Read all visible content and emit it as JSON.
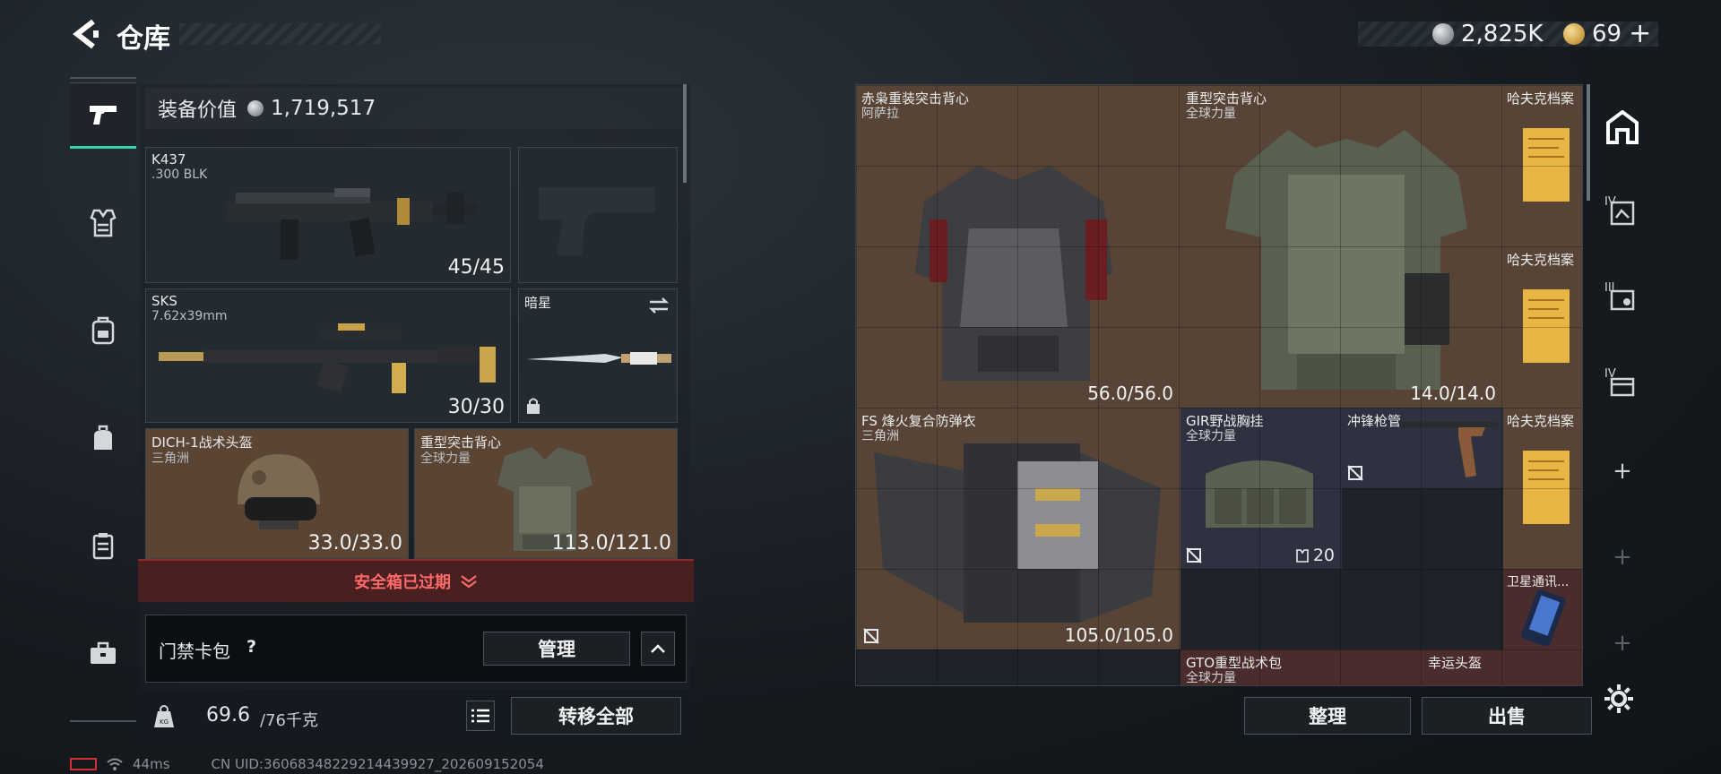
{
  "header": {
    "back_icon": "back-arrow-icon",
    "title": "仓库",
    "silver_amount": "2,825K",
    "gold_amount": "69",
    "gold_plus": "+"
  },
  "left_nav": {
    "items": [
      {
        "name": "weapons",
        "icon": "pistol-icon",
        "glyph": "⌐"
      },
      {
        "name": "vest",
        "icon": "vest-icon",
        "glyph": "⛊"
      },
      {
        "name": "backpack",
        "icon": "backpack-icon",
        "glyph": "⊡"
      },
      {
        "name": "bag",
        "icon": "bag-icon",
        "glyph": "◉"
      },
      {
        "name": "case",
        "icon": "case-icon",
        "glyph": "▤"
      },
      {
        "name": "toolbox",
        "icon": "toolbox-icon",
        "glyph": "⊟"
      }
    ]
  },
  "equipment": {
    "value_label": "装备价值",
    "value": "1,719,517",
    "primary": {
      "name": "K437",
      "ammo": ".300 BLK",
      "count": "45/45"
    },
    "sidearm": {
      "name": "",
      "count": ""
    },
    "secondary": {
      "name": "SKS",
      "ammo": "7.62x39mm",
      "count": "30/30"
    },
    "melee": {
      "name": "暗星"
    },
    "helmet": {
      "name": "DICH-1战术头盔",
      "origin": "三角洲",
      "count": "33.0/33.0"
    },
    "armor": {
      "name": "重型突击背心",
      "origin": "全球力量",
      "count": "113.0/121.0"
    },
    "safe_box": "安全箱已过期",
    "card_pack": "门禁卡包",
    "help_mark": "?",
    "manage": "管理",
    "weight": "69.6",
    "weight_max": "/76千克",
    "transfer_all": "转移全部"
  },
  "stash": {
    "items": [
      {
        "name": "赤枭重装突击背心",
        "origin": "阿萨拉",
        "count": "56.0/56.0"
      },
      {
        "name": "重型突击背心",
        "origin": "全球力量",
        "count": "14.0/14.0"
      },
      {
        "name": "哈夫克档案",
        "origin": "",
        "count": ""
      },
      {
        "name": "哈夫克档案",
        "origin": "",
        "count": ""
      },
      {
        "name": "FS 烽火复合防弹衣",
        "origin": "三角洲",
        "count": "105.0/105.0"
      },
      {
        "name": "GIR野战胸挂",
        "origin": "全球力量",
        "count": "20"
      },
      {
        "name": "冲锋枪管",
        "origin": "",
        "count": ""
      },
      {
        "name": "哈夫克档案",
        "origin": "",
        "count": ""
      },
      {
        "name": "卫星通讯...",
        "origin": "",
        "count": ""
      },
      {
        "name": "GTO重型战术包",
        "origin": "全球力量",
        "count": ""
      },
      {
        "name": "幸运头盔",
        "origin": "",
        "count": ""
      }
    ],
    "organize": "整理",
    "sell": "出售"
  },
  "right_nav": {
    "items": [
      {
        "label": "",
        "icon": "stash-home-icon"
      },
      {
        "label": "IV",
        "icon": "stash-tab-icon"
      },
      {
        "label": "III",
        "icon": "stash-tab-icon"
      },
      {
        "label": "IV",
        "icon": "stash-tab-icon"
      },
      {
        "label": "+",
        "icon": "add-tab-icon"
      },
      {
        "label": "+",
        "icon": "add-tab-icon"
      },
      {
        "label": "+",
        "icon": "add-tab-icon"
      }
    ]
  },
  "status_bar": {
    "ping": "44ms",
    "uid": "CN UID:36068348229214439927_202609152054"
  },
  "colors": {
    "accent": "#2fd4b0",
    "danger": "#ff6a6a",
    "tile_brown": "#574436"
  }
}
